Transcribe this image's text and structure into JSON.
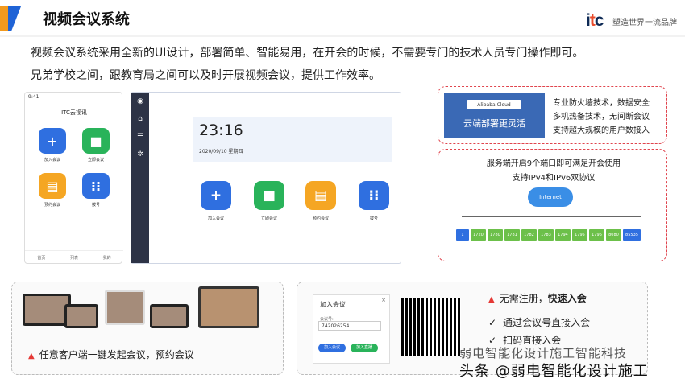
{
  "header": {
    "title": "视频会议系统",
    "logo_text": "itc",
    "slogan": "塑造世界一流品牌"
  },
  "intro": [
    "视频会议系统采用全新的UI设计，部署简单、智能易用，在开会的时候，不需要专门的技术人员专门操作即可。",
    "兄弟学校之间，跟教育局之间可以及时开展视频会议，提供工作效率。"
  ],
  "phone": {
    "status_time": "9:41",
    "title": "ITC云视讯",
    "tiles": [
      {
        "label": "加入会议",
        "icon": "plus-icon",
        "color": "#2f6fe0"
      },
      {
        "label": "立即会议",
        "icon": "video-icon",
        "color": "#29b35a"
      },
      {
        "label": "预约会议",
        "icon": "calendar-icon",
        "color": "#f5a623"
      },
      {
        "label": "拨号",
        "icon": "dialpad-icon",
        "color": "#2f6fe0"
      }
    ],
    "nav": [
      "首页",
      "列表",
      "我的"
    ]
  },
  "desktop": {
    "clock": "23:16",
    "date": "2020/09/10 星期四",
    "tiles": [
      {
        "label": "加入会议",
        "icon": "plus-icon",
        "color": "#2f6fe0"
      },
      {
        "label": "立即会议",
        "icon": "video-icon",
        "color": "#29b35a"
      },
      {
        "label": "预约会议",
        "icon": "calendar-icon",
        "color": "#f5a623"
      },
      {
        "label": "拨号",
        "icon": "dialpad-icon",
        "color": "#2f6fe0"
      }
    ]
  },
  "cloud": {
    "chip": "Alibaba Cloud",
    "caption": "云端部署更灵活",
    "features": [
      "专业防火墙技术，数据安全",
      "多机热备技术，无间断会议",
      "支持超大规模的用户数接入"
    ]
  },
  "network": {
    "line1": "服务端开启9个端口即可满足开会使用",
    "line2": "支持IPv4和IPv6双协议",
    "cloud_label": "Internet",
    "ports": [
      "1",
      "1720",
      "1780",
      "1781",
      "1782",
      "1783",
      "1794",
      "1795",
      "1796",
      "8080",
      "85535"
    ]
  },
  "bottom_left": {
    "caption": "任意客户端一键发起会议，预约会议"
  },
  "dialog": {
    "title": "加入会议",
    "field_label": "会议号:",
    "field_value": "742026254",
    "btn1": "加入会议",
    "btn2": "加入直播"
  },
  "bottom_right": {
    "headline_a": "无需注册，",
    "headline_b": "快速入会",
    "checks": [
      "通过会议号直接入会",
      "扫码直接入会"
    ]
  },
  "watermark": {
    "line1": "头条 @弱电智能化设计施工",
    "line2": "弱电智能化设计施工智能科技"
  },
  "colors": {
    "accent": "#1f63d6",
    "orange": "#f29a1e",
    "red": "#e53935"
  }
}
